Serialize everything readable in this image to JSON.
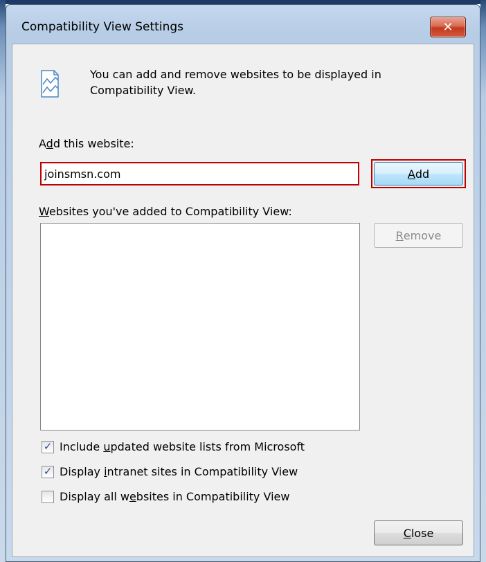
{
  "window": {
    "title": "Compatibility View Settings",
    "close_glyph": "✕"
  },
  "info": {
    "icon": "document-with-chart-icon",
    "text": "You can add and remove websites to be displayed in Compatibility View."
  },
  "add_section": {
    "label_pre": "A",
    "label_key": "d",
    "label_post": "d this website:",
    "input_value": "joinsmsn.com",
    "add_button_key": "A",
    "add_button_rest": "dd"
  },
  "sites_section": {
    "label_key": "W",
    "label_post": "ebsites you've added to Compatibility View:",
    "items": [],
    "remove_key": "R",
    "remove_rest": "emove"
  },
  "options": [
    {
      "pre": "Include ",
      "key": "u",
      "post": "pdated website lists from Microsoft",
      "checked": true
    },
    {
      "pre": "Display ",
      "key": "i",
      "post": "ntranet sites in Compatibility View",
      "checked": true
    },
    {
      "pre": "Display all w",
      "key": "e",
      "post": "bsites in Compatibility View",
      "checked": false
    }
  ],
  "close_button": {
    "key": "C",
    "rest": "lose"
  },
  "colors": {
    "highlight_outline": "#c00000",
    "checkmark": "#2a4e9a"
  }
}
